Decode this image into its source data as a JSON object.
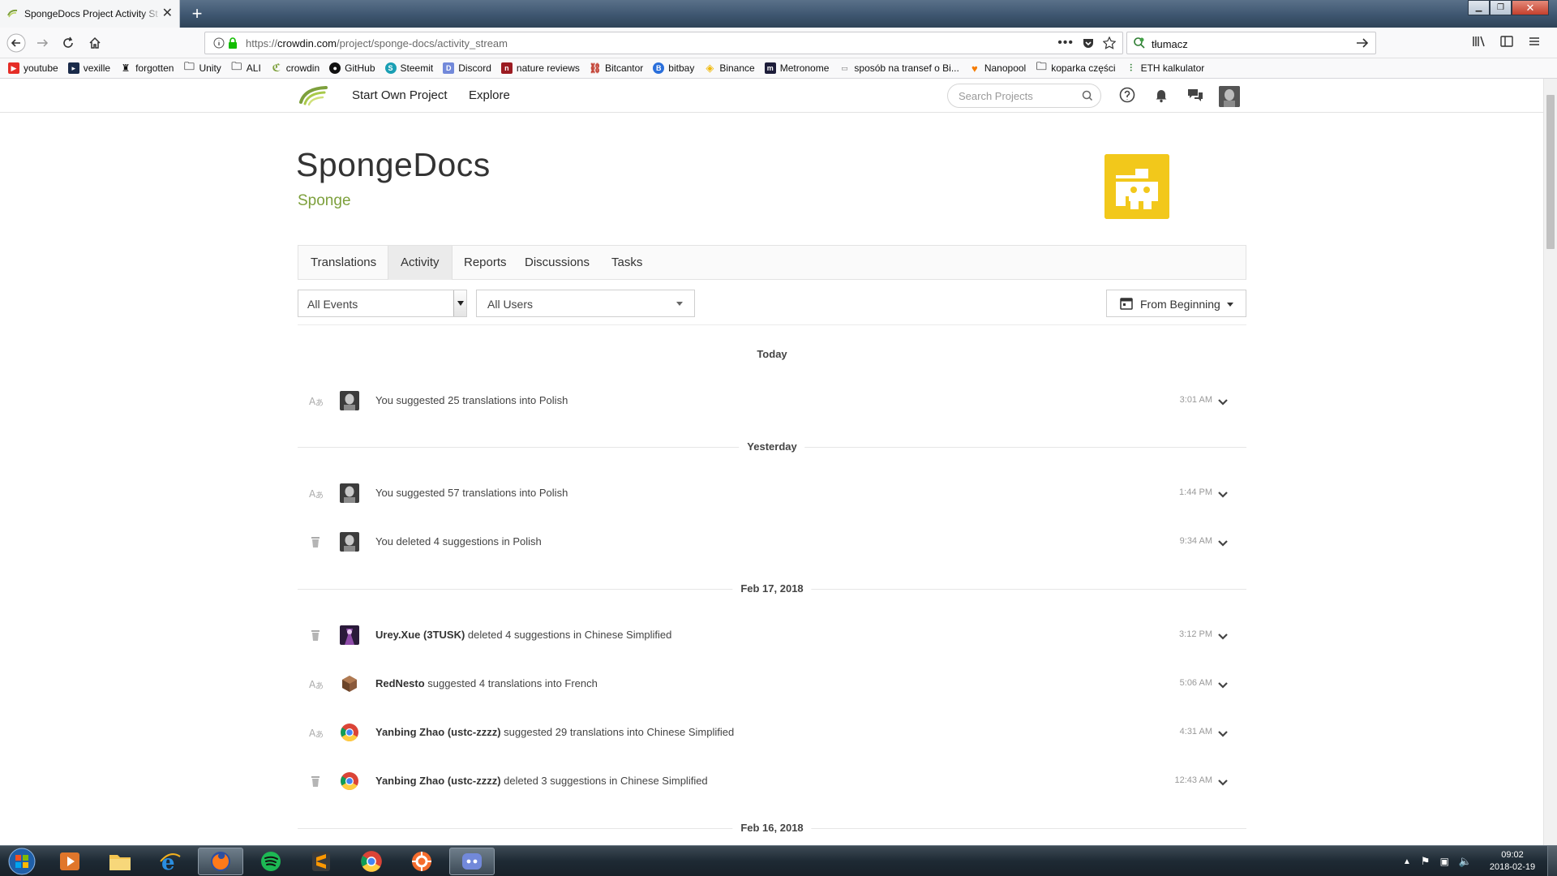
{
  "browser": {
    "tab_title": "SpongeDocs Project Activity St",
    "tab_close": "✕",
    "new_tab": "+",
    "url_prefix": "https://",
    "url_domain": "crowdin.com",
    "url_path": "/project/sponge-docs/activity_stream",
    "search_value": "tłumacz",
    "bookmarks": [
      "youtube",
      "vexille",
      "forgotten",
      "Unity",
      "ALI",
      "crowdin",
      "GitHub",
      "Steemit",
      "Discord",
      "nature reviews",
      "Bitcantor",
      "bitbay",
      "Binance",
      "Metronome",
      "sposób na transef o Bi...",
      "Nanopool",
      "koparka części",
      "ETH kalkulator"
    ]
  },
  "site": {
    "nav_start": "Start Own Project",
    "nav_explore": "Explore",
    "search_placeholder": "Search Projects"
  },
  "project": {
    "title": "SpongeDocs",
    "org": "Sponge",
    "tabs": [
      "Translations",
      "Activity",
      "Reports",
      "Discussions",
      "Tasks"
    ],
    "active_tab": "Activity"
  },
  "filters": {
    "events": "All Events",
    "users": "All Users",
    "date": "From Beginning"
  },
  "groups": [
    {
      "label": "Today",
      "items": [
        {
          "type": "suggest",
          "who": "",
          "text": "You suggested 25 translations into Polish",
          "time": "3:01 AM",
          "avatar": "self"
        }
      ]
    },
    {
      "label": "Yesterday",
      "items": [
        {
          "type": "suggest",
          "who": "",
          "text": "You suggested 57 translations into Polish",
          "time": "1:44 PM",
          "avatar": "self"
        },
        {
          "type": "delete",
          "who": "",
          "text": "You deleted 4 suggestions in Polish",
          "time": "9:34 AM",
          "avatar": "self"
        }
      ]
    },
    {
      "label": "Feb 17, 2018",
      "items": [
        {
          "type": "delete",
          "who": "Urey.Xue (3TUSK)",
          "text": " deleted 4 suggestions in Chinese Simplified",
          "time": "3:12 PM",
          "avatar": "urey"
        },
        {
          "type": "suggest",
          "who": "RedNesto",
          "text": " suggested 4 translations into French",
          "time": "5:06 AM",
          "avatar": "rednesto"
        },
        {
          "type": "suggest",
          "who": "Yanbing Zhao (ustc-zzzz)",
          "text": " suggested 29 translations into Chinese Simplified",
          "time": "4:31 AM",
          "avatar": "chrome"
        },
        {
          "type": "delete",
          "who": "Yanbing Zhao (ustc-zzzz)",
          "text": " deleted 3 suggestions in Chinese Simplified",
          "time": "12:43 AM",
          "avatar": "chrome"
        }
      ]
    },
    {
      "label": "Feb 16, 2018",
      "items": []
    }
  ],
  "taskbar": {
    "time": "09:02",
    "date": "2018-02-19"
  },
  "colors": {
    "accent_green": "#7da03c",
    "logo_yellow": "#f2c81b"
  }
}
